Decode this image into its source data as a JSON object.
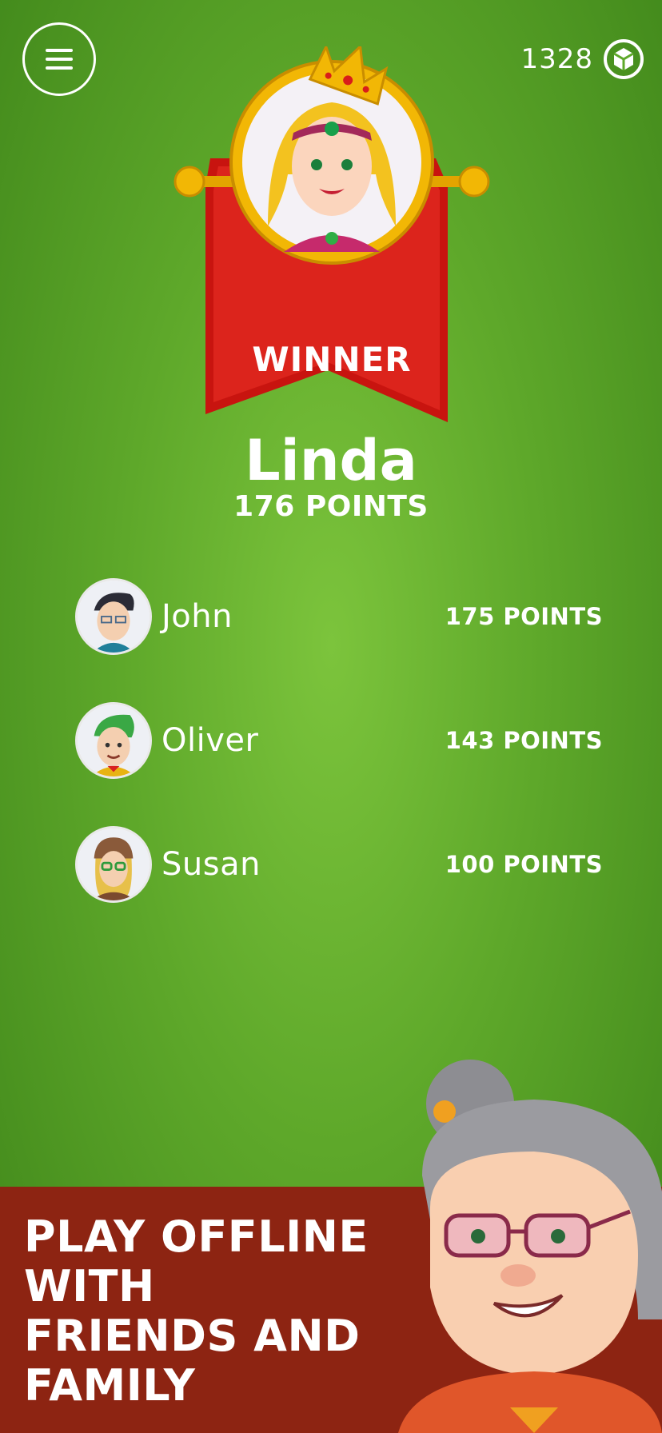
{
  "header": {
    "menu_icon": "hamburger-menu-icon",
    "coins": "1328",
    "coin_icon": "cube-coin-icon"
  },
  "winner": {
    "label": "WINNER",
    "name": "Linda",
    "points": "176 POINTS",
    "banner_color": "#d81e1a",
    "gold_color": "#f2b705"
  },
  "players": [
    {
      "name": "John",
      "points": "175 POINTS"
    },
    {
      "name": "Oliver",
      "points": "143 POINTS"
    },
    {
      "name": "Susan",
      "points": "100 POINTS"
    }
  ],
  "promo": {
    "lines": [
      "PLAY OFFLINE",
      "WITH",
      "FRIENDS AND",
      "FAMILY"
    ],
    "background": "#8d2412"
  }
}
